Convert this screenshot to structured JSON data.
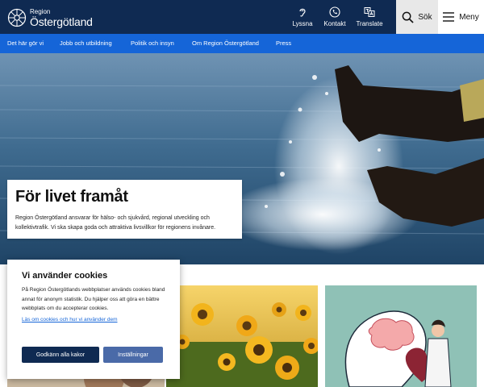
{
  "header": {
    "logo_small": "Region",
    "logo_big": "Östergötland",
    "tools": {
      "listen_label": "Lyssna",
      "contact_label": "Kontakt",
      "translate_label": "Translate"
    },
    "search_label": "Sök",
    "menu_label": "Meny"
  },
  "nav": {
    "items": [
      {
        "label": "Det här gör vi"
      },
      {
        "label": "Jobb och utbildning"
      },
      {
        "label": "Politik och insyn"
      },
      {
        "label": "Om Region Östergötland"
      },
      {
        "label": "Press"
      }
    ]
  },
  "hero": {
    "title": "För livet framåt",
    "text": "Region Östergötland ansvarar för hälso- och sjukvård, regional utveckling och kollektivtrafik. Vi ska skapa goda och attraktiva livsvillkor för regionens invånare."
  },
  "cookie": {
    "title": "Vi använder cookies",
    "text": "På Region Östergötlands webbplatser används cookies bland annat för anonym statistik. Du hjälper oss att göra en bättre webbplats om du accepterar cookies.",
    "link": "Läs om cookies och hur vi använder dem",
    "accept_label": "Godkänn alla kakor",
    "settings_label": "Inställningar"
  },
  "colors": {
    "header_bg": "#0f2a52",
    "nav_bg": "#1565d8",
    "link": "#1565d8",
    "accept_btn": "#0f2a52",
    "settings_btn": "#4a6aa8"
  },
  "icons": {
    "logo": "sun-emblem-icon",
    "listen": "ear-icon",
    "contact": "phone-icon",
    "translate": "translate-icon",
    "search": "search-icon",
    "menu": "hamburger-icon"
  }
}
